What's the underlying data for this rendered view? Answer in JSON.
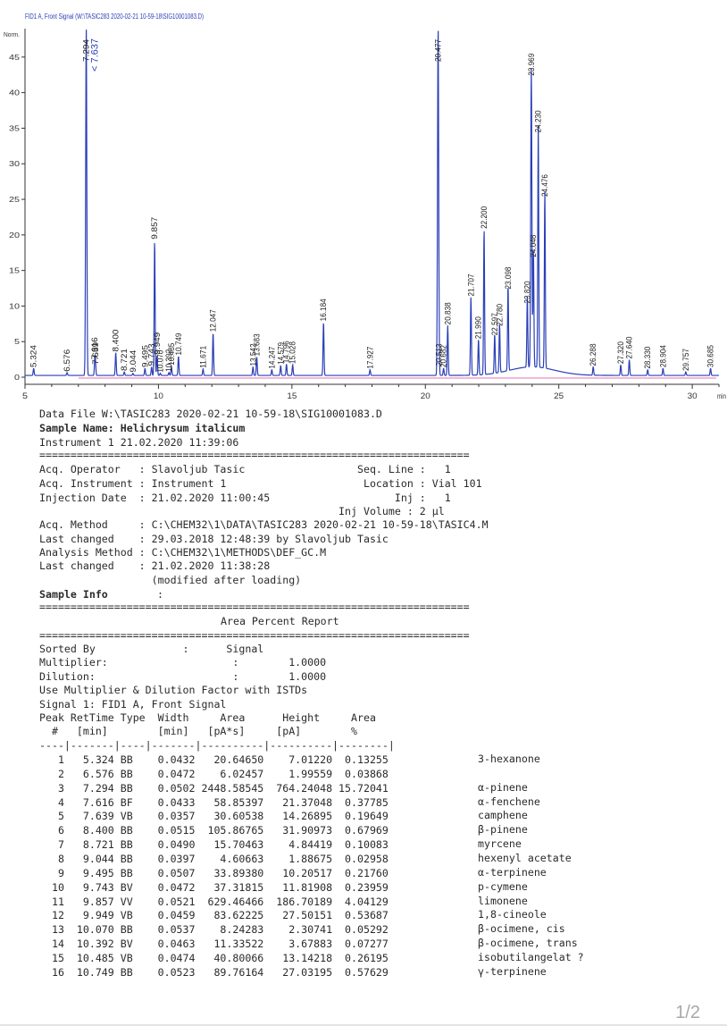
{
  "chart_header": "FID1 A, Front Signal (W:\\TASIC283 2020-02-21 10-59-18\\SIG10001083.D)",
  "chart_data": {
    "type": "line",
    "title": "FID1 A, Front Signal (W:\\TASIC283 2020-02-21 10-59-18\\SIG10001083.D)",
    "ylabel": "Norm.",
    "xlabel": "min",
    "xlim": [
      5,
      31
    ],
    "ylim": [
      -1,
      49
    ],
    "x_ticks": [
      5,
      10,
      15,
      20,
      25,
      30
    ],
    "y_ticks": [
      0,
      5,
      10,
      15,
      20,
      25,
      30,
      35,
      40,
      45
    ],
    "peaks": [
      {
        "rt": 5.324,
        "h": 1.0,
        "label": "5.324"
      },
      {
        "rt": 6.576,
        "h": 0.4,
        "label": "6.576"
      },
      {
        "rt": 7.294,
        "h": 49,
        "label": "7.294"
      },
      {
        "rt": 7.616,
        "h": 2.1,
        "label": "7.616"
      },
      {
        "rt": 7.639,
        "h": 1.4,
        "label": "7.639"
      },
      {
        "rt": 8.4,
        "h": 3.2,
        "label": "8.400"
      },
      {
        "rt": 8.721,
        "h": 0.5,
        "label": "8.721"
      },
      {
        "rt": 9.044,
        "h": 0.3,
        "label": "9.044"
      },
      {
        "rt": 9.495,
        "h": 1.0,
        "label": "9.495"
      },
      {
        "rt": 9.743,
        "h": 1.2,
        "label": "9.743"
      },
      {
        "rt": 9.857,
        "h": 19.0,
        "label": "9.857"
      },
      {
        "rt": 9.949,
        "h": 2.8,
        "label": "9.949"
      },
      {
        "rt": 10.07,
        "h": 0.3,
        "label": "10.070"
      },
      {
        "rt": 10.392,
        "h": 0.4,
        "label": "10.392"
      },
      {
        "rt": 10.485,
        "h": 1.3,
        "label": "10.485"
      },
      {
        "rt": 10.749,
        "h": 2.7,
        "label": "10.749"
      },
      {
        "rt": 11.671,
        "h": 0.9,
        "label": "11.671"
      },
      {
        "rt": 12.047,
        "h": 6.0,
        "label": "12.047"
      },
      {
        "rt": 13.542,
        "h": 1.2,
        "label": "13.542"
      },
      {
        "rt": 13.683,
        "h": 2.6,
        "label": "13.683"
      },
      {
        "rt": 14.247,
        "h": 0.8,
        "label": "14.247"
      },
      {
        "rt": 14.579,
        "h": 1.4,
        "label": "14.579"
      },
      {
        "rt": 14.796,
        "h": 1.6,
        "label": "14.796"
      },
      {
        "rt": 15.028,
        "h": 1.5,
        "label": "15.028"
      },
      {
        "rt": 16.184,
        "h": 7.5,
        "label": "16.184"
      },
      {
        "rt": 17.927,
        "h": 0.8,
        "label": "17.927"
      },
      {
        "rt": 20.477,
        "h": 49,
        "label": "20.477"
      },
      {
        "rt": 20.513,
        "h": 1.2,
        "label": "20.513"
      },
      {
        "rt": 20.682,
        "h": 1.0,
        "label": "20.682"
      },
      {
        "rt": 20.838,
        "h": 7.0,
        "label": "20.838"
      },
      {
        "rt": 21.707,
        "h": 11.0,
        "label": "21.707"
      },
      {
        "rt": 21.99,
        "h": 5.0,
        "label": "21.990"
      },
      {
        "rt": 22.2,
        "h": 20.5,
        "label": "22.200"
      },
      {
        "rt": 22.597,
        "h": 5.5,
        "label": "22.597"
      },
      {
        "rt": 22.78,
        "h": 6.8,
        "label": "22.780"
      },
      {
        "rt": 23.098,
        "h": 12.0,
        "label": "23.098"
      },
      {
        "rt": 23.82,
        "h": 10.0,
        "label": "23.820"
      },
      {
        "rt": 23.969,
        "h": 42.0,
        "label": "23.969"
      },
      {
        "rt": 24.048,
        "h": 16.5,
        "label": "24.048"
      },
      {
        "rt": 24.23,
        "h": 34.0,
        "label": "24.230"
      },
      {
        "rt": 24.476,
        "h": 25.0,
        "label": "24.476"
      },
      {
        "rt": 26.288,
        "h": 1.2,
        "label": "26.288"
      },
      {
        "rt": 27.32,
        "h": 1.5,
        "label": "27.320"
      },
      {
        "rt": 27.64,
        "h": 2.2,
        "label": "27.640"
      },
      {
        "rt": 28.33,
        "h": 0.8,
        "label": "28.330"
      },
      {
        "rt": 28.904,
        "h": 1.0,
        "label": "28.904"
      },
      {
        "rt": 29.757,
        "h": 0.5,
        "label": "29.757"
      },
      {
        "rt": 30.685,
        "h": 1.0,
        "label": "30.685"
      }
    ]
  },
  "report": {
    "data_file": "Data File W:\\TASIC283 2020-02-21 10-59-18\\SIG10001083.D",
    "sample_name_label": "Sample Name:",
    "sample_name": "Helichrysum italicum",
    "instrument_line": "Instrument 1 21.02.2020 11:39:06",
    "sep_line": "=====================================================================",
    "acq_operator": "Acq. Operator   : Slavoljub Tasic                  Seq. Line :   1",
    "acq_instrument": "Acq. Instrument : Instrument 1                      Location : Vial 101",
    "injection_date": "Injection Date  : 21.02.2020 11:00:45                    Inj :   1",
    "inj_volume": "                                                Inj Volume : 2 µl",
    "acq_method": "Acq. Method     : C:\\CHEM32\\1\\DATA\\TASIC283 2020-02-21 10-59-18\\TASIC4.M",
    "last_changed_1": "Last changed    : 29.03.2018 12:48:39 by Slavoljub Tasic",
    "analysis_method": "Analysis Method : C:\\CHEM32\\1\\METHODS\\DEF_GC.M",
    "last_changed_2": "Last changed    : 21.02.2020 11:38:28",
    "modified": "                  (modified after loading)",
    "sample_info": "Sample Info",
    "sample_info_colon": ":",
    "report_title": "Area Percent Report",
    "sorted_by": "Sorted By              :      Signal",
    "multiplier": "Multiplier:                    :        1.0000",
    "dilution": "Dilution:                      :        1.0000",
    "istd_line": "Use Multiplier & Dilution Factor with ISTDs",
    "signal_line": "Signal 1: FID1 A, Front Signal",
    "header_1": "Peak RetTime Type  Width     Area      Height     Area",
    "header_2": "  #   [min]        [min]   [pA*s]     [pA]        %",
    "header_sep": "----|-------|----|-------|----------|----------|--------|",
    "rows": [
      {
        "line": "   1   5.324 BB    0.0432   20.64650    7.01220  0.13255",
        "compound": "3-hexanone"
      },
      {
        "line": "   2   6.576 BB    0.0472    6.02457    1.99559  0.03868",
        "compound": ""
      },
      {
        "line": "   3   7.294 BB    0.0502 2448.58545  764.24048 15.72041",
        "compound": "α-pinene"
      },
      {
        "line": "   4   7.616 BF    0.0433   58.85397   21.37048  0.37785",
        "compound": "α-fenchene"
      },
      {
        "line": "   5   7.639 VB    0.0357   30.60538   14.26895  0.19649",
        "compound": "camphene"
      },
      {
        "line": "   6   8.400 BB    0.0515  105.86765   31.90973  0.67969",
        "compound": "β-pinene"
      },
      {
        "line": "   7   8.721 BB    0.0490   15.70463    4.84419  0.10083",
        "compound": "myrcene"
      },
      {
        "line": "   8   9.044 BB    0.0397    4.60663    1.88675  0.02958",
        "compound": "hexenyl acetate"
      },
      {
        "line": "   9   9.495 BB    0.0507   33.89380   10.20517  0.21760",
        "compound": "α-terpinene"
      },
      {
        "line": "  10   9.743 BV    0.0472   37.31815   11.81908  0.23959",
        "compound": "p-cymene"
      },
      {
        "line": "  11   9.857 VV    0.0521  629.46466  186.70189  4.04129",
        "compound": "limonene"
      },
      {
        "line": "  12   9.949 VB    0.0459   83.62225   27.50151  0.53687",
        "compound": "1,8-cineole"
      },
      {
        "line": "  13  10.070 BB    0.0537    8.24283    2.30741  0.05292",
        "compound": "β-ocimene, cis"
      },
      {
        "line": "  14  10.392 BV    0.0463   11.33522    3.67883  0.07277",
        "compound": "β-ocimene, trans"
      },
      {
        "line": "  15  10.485 VB    0.0474   40.80066   13.14218  0.26195",
        "compound": "isobutilangelat ?"
      },
      {
        "line": "  16  10.749 BB    0.0523   89.76164   27.03195  0.57629",
        "compound": "γ-terpinene"
      }
    ]
  },
  "pager": "1/2"
}
